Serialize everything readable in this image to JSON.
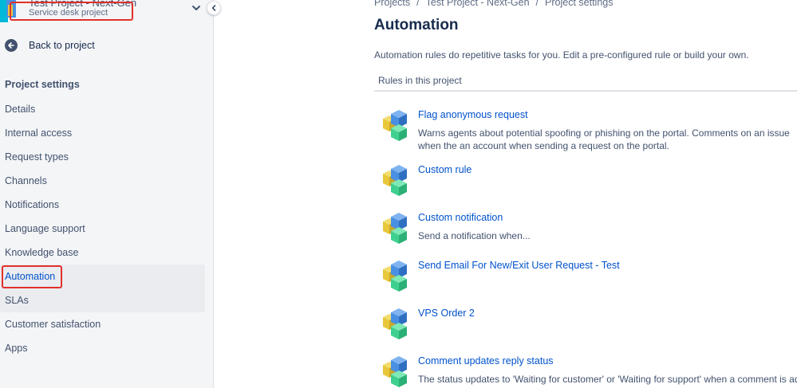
{
  "project": {
    "name": "Test Project - Next-Gen",
    "type": "Service desk project"
  },
  "sidebar": {
    "back_label": "Back to project",
    "section_title": "Project settings",
    "items": [
      {
        "label": "Details"
      },
      {
        "label": "Internal access"
      },
      {
        "label": "Request types"
      },
      {
        "label": "Channels"
      },
      {
        "label": "Notifications"
      },
      {
        "label": "Language support"
      },
      {
        "label": "Knowledge base"
      },
      {
        "label": "Automation",
        "active": true
      },
      {
        "label": "SLAs"
      },
      {
        "label": "Customer satisfaction"
      },
      {
        "label": "Apps"
      }
    ]
  },
  "breadcrumb": [
    "Projects",
    "Test Project - Next-Gen",
    "Project settings"
  ],
  "page": {
    "title": "Automation",
    "intro": "Automation rules do repetitive tasks for you. Edit a pre-configured rule or build your own.",
    "rules_header": "Rules in this project"
  },
  "rules": [
    {
      "title": "Flag anonymous request",
      "description": "Warns agents about potential spoofing or phishing on the portal. Comments on an issue when the an account when sending a request on the portal."
    },
    {
      "title": "Custom rule",
      "description": ""
    },
    {
      "title": "Custom notification",
      "description": "Send a notification when..."
    },
    {
      "title": "Send Email For New/Exit User Request - Test",
      "description": ""
    },
    {
      "title": "VPS Order 2",
      "description": ""
    },
    {
      "title": "Comment updates reply status",
      "description": "The status updates to 'Waiting for customer' or 'Waiting for support' when a comment is added to a"
    }
  ],
  "colors": {
    "link": "#0052cc",
    "highlight": "#e0312b",
    "sidebar_bg": "#f4f5f7",
    "cube_blue": "#4a90e2",
    "cube_yellow": "#e8c73a",
    "cube_green": "#3fd08f"
  },
  "icons": {
    "back": "arrow-left-icon",
    "collapse": "chevron-left-icon",
    "expand": "chevron-down-icon",
    "rule": "automation-cubes-icon"
  }
}
